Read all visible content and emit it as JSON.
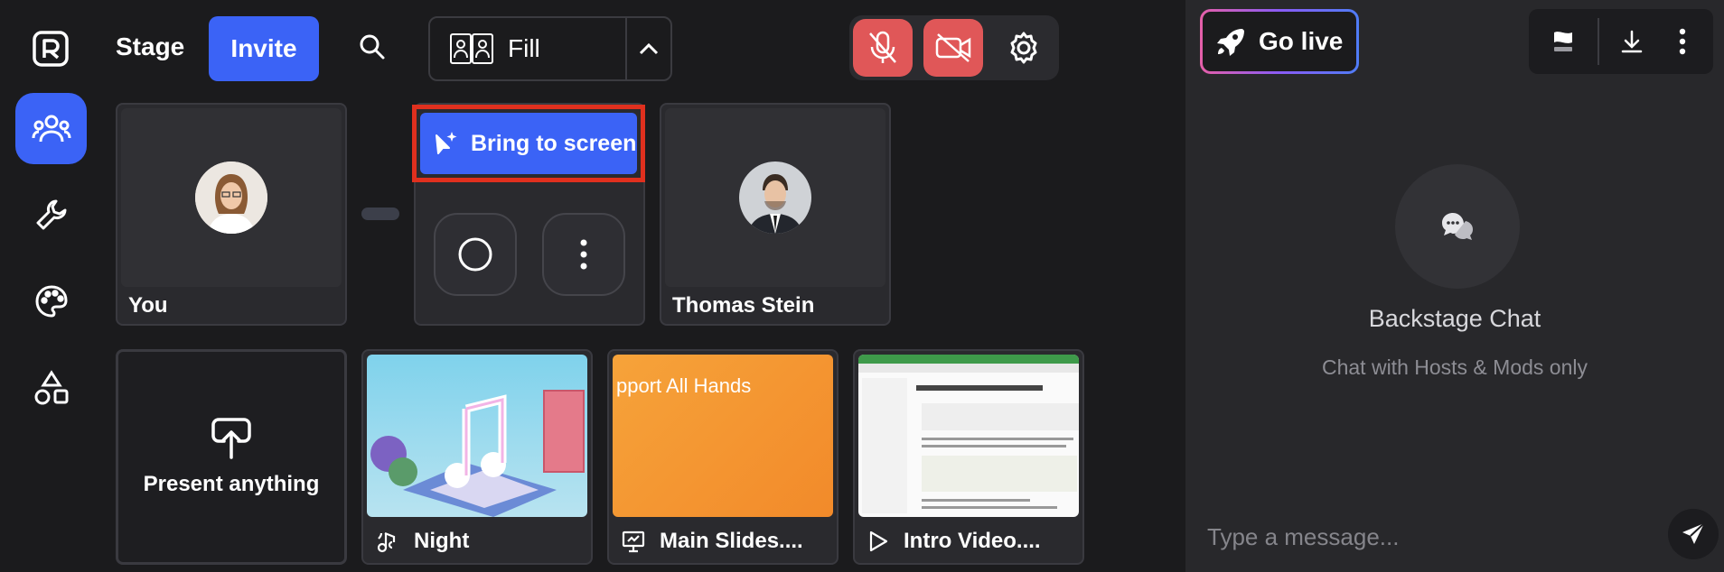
{
  "topbar": {
    "tab_stage": "Stage",
    "invite_label": "Invite",
    "layout_label": "Fill"
  },
  "stage": {
    "you_label": "You",
    "bring_to_screen_label": "Bring to screen",
    "guest_name": "Thomas Stein"
  },
  "media": {
    "present_label": "Present anything",
    "items": [
      {
        "label": "Night",
        "icon": "audio-icon"
      },
      {
        "label": "Main Slides....",
        "icon": "slides-icon",
        "thumb_text": "pport All Hands"
      },
      {
        "label": "Intro Video....",
        "icon": "play-icon"
      }
    ]
  },
  "panel": {
    "go_live_label": "Go live",
    "chat_title": "Backstage Chat",
    "chat_subtitle": "Chat with Hosts & Mods only",
    "message_placeholder": "Type a message..."
  },
  "colors": {
    "accent": "#3b63f6",
    "muted_red": "#e05758",
    "highlight_outline": "#e0301e",
    "background": "#1b1b1d",
    "panel": "#28282b"
  }
}
